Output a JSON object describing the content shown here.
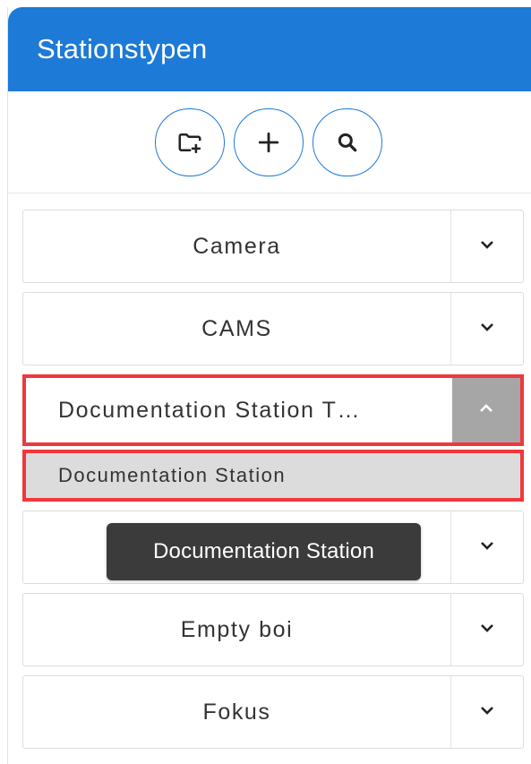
{
  "header": {
    "title": "Stationstypen"
  },
  "toolbar": {
    "buttons": [
      {
        "name": "add-folder-button",
        "icon": "folder-plus-icon"
      },
      {
        "name": "add-button",
        "icon": "plus-icon"
      },
      {
        "name": "search-button",
        "icon": "search-icon"
      }
    ]
  },
  "list": {
    "groups": [
      {
        "label": "Camera",
        "expanded": false
      },
      {
        "label": "CAMS",
        "expanded": false
      },
      {
        "label": "Documentation Station T…",
        "expanded": true,
        "children": [
          {
            "label": "Documentation Station"
          }
        ]
      },
      {
        "label": "",
        "expanded": false
      },
      {
        "label": "Empty boi",
        "expanded": false
      },
      {
        "label": "Fokus",
        "expanded": false
      }
    ]
  },
  "tooltip": {
    "text": "Documentation Station"
  },
  "colors": {
    "header_bg": "#1d7ad6",
    "button_border": "#1d7ad6",
    "highlight_border": "#f0373c",
    "selected_bg": "#dcdcdc",
    "expanded_toggle_bg": "#a6a6a6",
    "tooltip_bg": "#3b3b3b"
  }
}
